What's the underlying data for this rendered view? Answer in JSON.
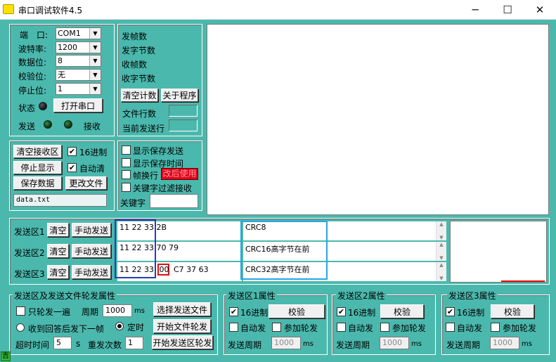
{
  "window": {
    "title": "串口调试软件4.5",
    "min_icon": "─",
    "max_icon": "☐",
    "close_icon": "✕"
  },
  "port_panel": {
    "port_label": "端　口:",
    "port_value": "COM1",
    "baud_label": "波特率:",
    "baud_value": "1200",
    "databits_label": "数据位:",
    "databits_value": "8",
    "parity_label": "校验位:",
    "parity_value": "无",
    "stopbits_label": "停止位:",
    "stopbits_value": "1",
    "status_label": "状态",
    "open_button": "打开串口",
    "send_label": "发送",
    "receive_label": "接收"
  },
  "stats_panel": {
    "frames_sent": "发帧数",
    "bytes_sent": "发字节数",
    "frames_recv": "收帧数",
    "bytes_recv": "收字节数",
    "clear_button": "清空计数",
    "about_button": "关于程序",
    "file_lines_label": "文件行数",
    "current_line_label": "当前发送行"
  },
  "receive_controls": {
    "clear_button": "清空接收区",
    "hex_label": "16进制",
    "stop_button": "停止显示",
    "auto_clear_label": "自动清",
    "save_button": "保存数据",
    "change_file_button": "更改文件",
    "file_name": "data.txt"
  },
  "options": {
    "show_save_send": "显示保存发送",
    "show_save_time": "显示保存时间",
    "frame_newline": "帧换行",
    "no_use_badge": "改后使用",
    "keyword_filter": "关键字过滤接收",
    "keyword_label": "关键字"
  },
  "send_rows": [
    {
      "label": "发送区1",
      "clear": "清空",
      "manual": "手动发送",
      "hex": "11 22 33  2B",
      "comment": "CRC8"
    },
    {
      "label": "发送区2",
      "clear": "清空",
      "manual": "手动发送",
      "hex": "11 22 33   70 79",
      "comment": "CRC16高字节在前"
    },
    {
      "label": "发送区3",
      "clear": "清空",
      "manual": "手动发送",
      "hex_prefix": "11 22 33 ",
      "hex_boxed": "00",
      "hex_suffix": " C7 37 63",
      "comment": "CRC32高字节在前"
    }
  ],
  "rotation_group": {
    "title": "发送区及发送文件轮发属性",
    "only_once": "只轮发一遍",
    "period_label": "周期",
    "period_value": "1000",
    "period_unit": "ms",
    "select_file_button": "选择发送文件",
    "reply_next": "收到回答后发下一帧",
    "timed": "定时",
    "start_file_button": "开始文件轮发",
    "timeout_label": "超时时间",
    "timeout_value": "5",
    "timeout_unit": "s",
    "retries_label": "重发次数",
    "retries_value": "1",
    "start_area_button": "开始发送区轮发"
  },
  "send_props": [
    {
      "title": "发送区1属性",
      "hex": "16进制",
      "verify": "校验",
      "auto": "自动发",
      "join": "参加轮发",
      "period_label": "发送周期",
      "period_value": "1000",
      "unit": "ms"
    },
    {
      "title": "发送区2属性",
      "hex": "16进制",
      "verify": "校验",
      "auto": "自动发",
      "join": "参加轮发",
      "period_label": "发送周期",
      "period_value": "1000",
      "unit": "ms"
    },
    {
      "title": "发送区3属性",
      "hex": "16进制",
      "verify": "校验",
      "auto": "自动发",
      "join": "参加轮发",
      "period_label": "发送周期",
      "period_value": "1000",
      "unit": "ms"
    }
  ],
  "taskbar": {
    "glyph": "吉"
  },
  "colors": {
    "background": "#4bb8ad",
    "highlight_blue_dark": "#2b3bb5",
    "highlight_blue_light": "#2aa3e6",
    "highlight_red": "#e01010",
    "badge_red": "#e0001a"
  },
  "icons": {
    "check": "✔",
    "scroll_up": "▲",
    "scroll_down": "▼",
    "dropdown": "▼"
  }
}
